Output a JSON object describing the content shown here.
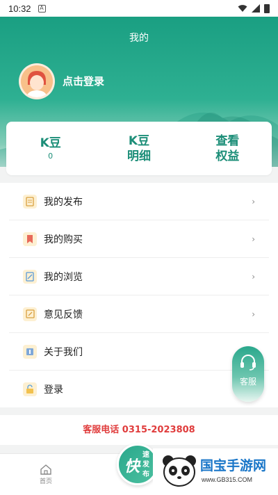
{
  "status_bar": {
    "time": "10:32",
    "notification_badge": "A"
  },
  "header": {
    "title": "我的",
    "login_text": "点击登录"
  },
  "stats": [
    {
      "title": "K豆",
      "value": "0"
    },
    {
      "title": "K豆",
      "title2": "明细"
    },
    {
      "title": "查看",
      "title2": "权益"
    }
  ],
  "menu": {
    "items": [
      {
        "label": "我的发布",
        "icon": "document-icon",
        "chevron": "›"
      },
      {
        "label": "我的购买",
        "icon": "bookmark-icon",
        "chevron": "›"
      },
      {
        "label": "我的浏览",
        "icon": "edit-doc-icon",
        "chevron": "›"
      },
      {
        "label": "意见反馈",
        "icon": "feedback-icon",
        "chevron": "›"
      },
      {
        "label": "关于我们",
        "icon": "info-icon"
      },
      {
        "label": "登录",
        "icon": "lock-icon"
      }
    ]
  },
  "service": {
    "text": "客服电话 0315-2023808"
  },
  "fab": {
    "label": "客服",
    "icon": "headset-icon"
  },
  "tabbar": {
    "home_label": "首页"
  },
  "publish": {
    "big": "快",
    "small_top": "速",
    "small_bottom": "发",
    "small_last": "布"
  },
  "watermark": {
    "title": "国宝手游网",
    "url": "www.GB315.COM"
  },
  "colors": {
    "primary": "#1a9f82",
    "accent_text": "#1c8e78",
    "service_red": "#e03c3c"
  }
}
